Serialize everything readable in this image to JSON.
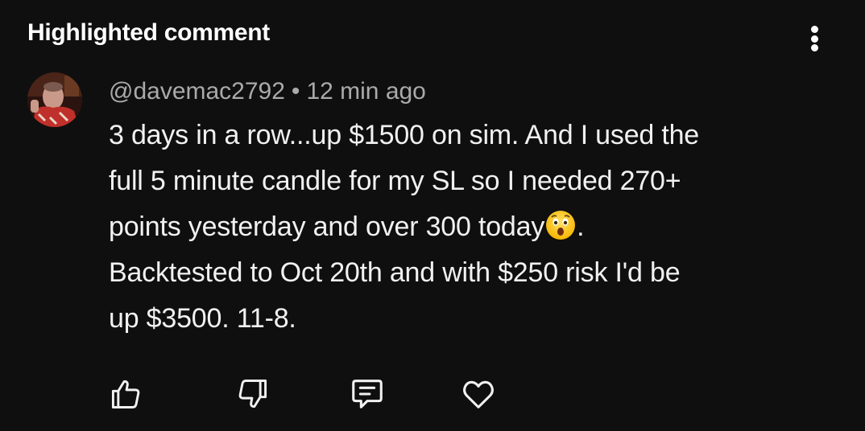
{
  "header": {
    "title": "Highlighted comment",
    "more_icon": "more-vertical-icon"
  },
  "comment": {
    "author": "@davemac2792",
    "separator": "•",
    "timestamp": "12 min ago",
    "lines": [
      "3 days in a row...up $1500 on sim.  And I used the",
      "full 5 minute candle for my SL so I needed 270+",
      "points yesterday and over 300 today",
      "Backtested to Oct 20th and with $250 risk I'd be",
      "up $3500.  11-8."
    ],
    "line3_suffix": ".",
    "emoji": "hushed-face-emoji"
  },
  "actions": {
    "like_icon": "thumbs-up-icon",
    "dislike_icon": "thumbs-down-icon",
    "reply_icon": "comment-reply-icon",
    "heart_icon": "heart-icon"
  },
  "colors": {
    "background": "#0f0f0f",
    "primary_text": "#f1f1f1",
    "secondary_text": "#aaaaaa"
  }
}
